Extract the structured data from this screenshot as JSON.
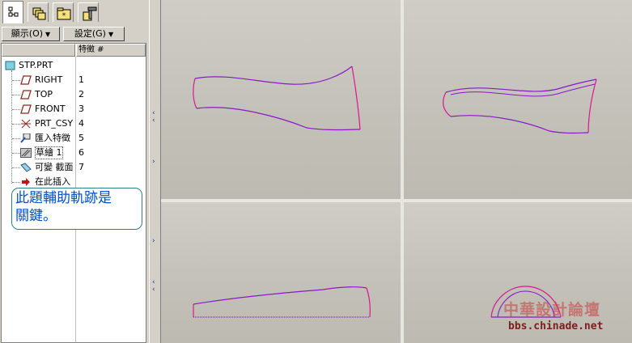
{
  "left_panel": {
    "tabs": [
      {
        "name": "model-tree-icon",
        "active": true
      },
      {
        "name": "layers-icon",
        "active": false
      },
      {
        "name": "folder-icon",
        "active": false
      },
      {
        "name": "favorites-icon",
        "active": false
      }
    ],
    "display_button": "顯示(O)",
    "settings_button": "設定(G)",
    "tree_header": "特徵 #",
    "tree": [
      {
        "label": "STP.PRT",
        "icon": "part-icon",
        "num": ""
      },
      {
        "label": "RIGHT",
        "icon": "datum-plane-icon",
        "num": "1"
      },
      {
        "label": "TOP",
        "icon": "datum-plane-icon",
        "num": "2"
      },
      {
        "label": "FRONT",
        "icon": "datum-plane-icon",
        "num": "3"
      },
      {
        "label": "PRT_CSY",
        "icon": "coordinate-system-icon",
        "num": "4"
      },
      {
        "label": "匯入特徵",
        "icon": "import-feature-icon",
        "num": "5"
      },
      {
        "label": "草繪 1",
        "icon": "sketch-icon",
        "num": "6"
      },
      {
        "label": "可變 截面",
        "icon": "variable-section-sweep-icon",
        "num": "7"
      },
      {
        "label": "在此插入",
        "icon": "insert-here-arrow-icon",
        "num": ""
      }
    ]
  },
  "callout": {
    "line1": "此題輔助軌跡是",
    "line2": "關鍵。"
  },
  "watermark": {
    "title": "中華設計論壇",
    "url": "bbs.chinade.net"
  },
  "colors": {
    "curve": "#8a18c8",
    "edge": "#d81890",
    "panel": "#d4d0c8",
    "callout_text": "#0050c0"
  }
}
